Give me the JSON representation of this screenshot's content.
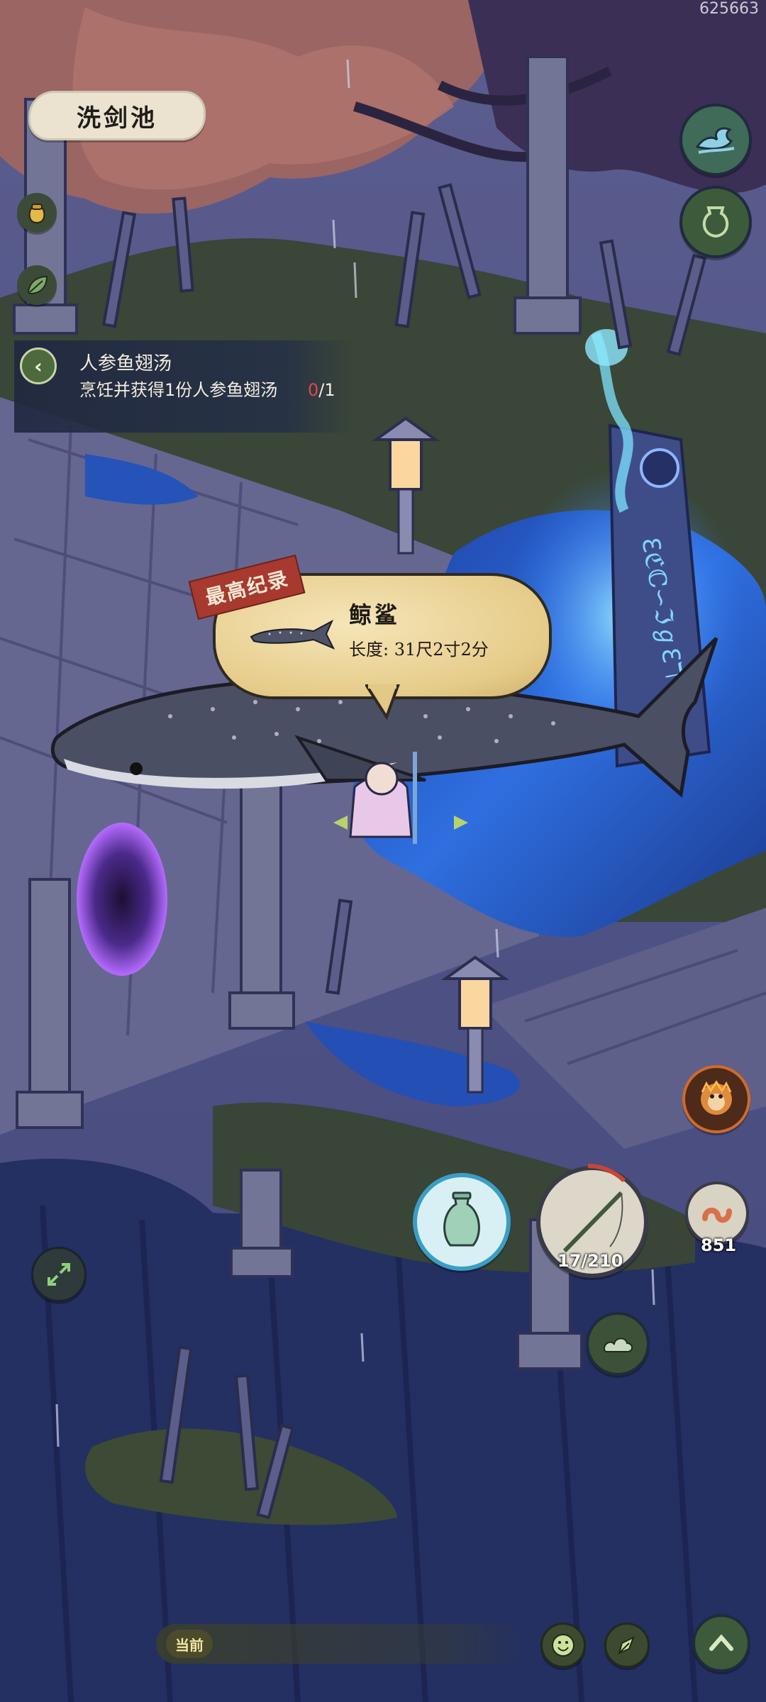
{
  "build_id": "625663",
  "location": {
    "name": "洗剑池"
  },
  "quest": {
    "title": "人参鱼翅汤",
    "description": "烹饪并获得1份人参鱼翅汤",
    "progress_current": "0",
    "progress_total": "/1"
  },
  "record": {
    "badge": "最高纪录",
    "fish_name": "鲸鲨",
    "length_text": "长度: 31尺2寸2分"
  },
  "fishing": {
    "line_count": "17/210"
  },
  "bait": {
    "count": "851"
  },
  "chat": {
    "channel": "当前"
  },
  "colors": {
    "water": "#2a63c9",
    "grass": "#3d4a3c",
    "accent_green": "#4d6a3f",
    "record_red": "#a8392f"
  }
}
